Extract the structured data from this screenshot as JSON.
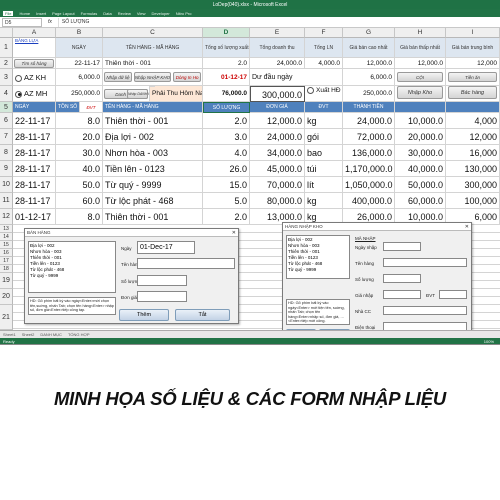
{
  "window": {
    "title": "LoDep(040).xlsx - Microsoft Excel"
  },
  "ribbon_tabs": [
    "File",
    "Home",
    "Insert",
    "Page Layout",
    "Formulas",
    "Data",
    "Review",
    "View",
    "Developer",
    "Nitro Pro"
  ],
  "formula_bar": {
    "name_box": "D5",
    "fx": "fx",
    "value": "SỐ LƯỢNG"
  },
  "columns": [
    "A",
    "B",
    "C",
    "D",
    "E",
    "F",
    "G",
    "H",
    "I"
  ],
  "rows": [
    "1",
    "2",
    "3",
    "4",
    "5",
    "6",
    "7",
    "8",
    "9",
    "10",
    "11",
    "12",
    "13",
    "14",
    "15",
    "16",
    "17",
    "18",
    "19",
    "20",
    "21"
  ],
  "top": {
    "r1": {
      "a_link": "BẢNG LỰA",
      "b": "NGÀY",
      "c": "TÊN HÀNG - MÃ HÀNG",
      "d": "Tổng số lượng xuất",
      "e": "Tổng doanh thu",
      "f": "Tổng LN",
      "g": "Giá bán cao nhất",
      "h": "Giá bán thấp nhất",
      "i": "Giá bán trung bình"
    },
    "r2": {
      "a_btn": "Tìm số hàng",
      "b": "22-11-17",
      "c": "Thiên thời - 001",
      "d": "2.0",
      "e": "24,000.0",
      "f": "4,000.0",
      "g": "12,000.0",
      "h": "12,000.0",
      "i": "12,000"
    },
    "r3": {
      "a_radio": "AZ KH",
      "b": "6,000.0",
      "btn1": "Nhập dữ liệ",
      "btn2": "Nhập NHẬP KHO",
      "btn3": "Dòng In Ho",
      "d_date": "01-12-17",
      "e": "Dư đầu ngày",
      "g": "6,000.0",
      "h": "CỘI",
      "i": "Tiền ăn"
    },
    "r4": {
      "a_radio": "AZ MH",
      "b": "250,000.0",
      "btn1": "Danh sách",
      "btn2": "Nhập DANH HÀNG",
      "c_text": "Phải Thu Hôm Nay",
      "d": "76,000.0",
      "e": "300,000.0",
      "f_radio": "Xuất HĐ",
      "g": "250,000.0",
      "h_btn": "Nhập Kho",
      "i_btn": "Bác hàng"
    },
    "r5": {
      "a": "NGÀY",
      "b1": "TỒN SỐ",
      "b2": "ĐVT",
      "c": "TÊN HÀNG - MÃ HÀNG",
      "d": "SỐ LƯỢNG",
      "e": "ĐƠN GIÁ",
      "f": "ĐVT",
      "g": "THÀNH TIỀN",
      "h": "",
      "i": ""
    }
  },
  "data_rows": [
    {
      "a": "22-11-17",
      "b": "8.0",
      "c": "Thiên thời - 001",
      "d": "2.0",
      "e": "12,000.0",
      "f": "kg",
      "g": "24,000.0",
      "h": "10,000.0",
      "i": "4,000"
    },
    {
      "a": "28-11-17",
      "b": "20.0",
      "c": "Địa lợi - 002",
      "d": "3.0",
      "e": "24,000.0",
      "f": "gói",
      "g": "72,000.0",
      "h": "20,000.0",
      "i": "12,000"
    },
    {
      "a": "28-11-17",
      "b": "30.0",
      "c": "Nhơn hòa - 003",
      "d": "4.0",
      "e": "34,000.0",
      "f": "bao",
      "g": "136,000.0",
      "h": "30,000.0",
      "i": "16,000"
    },
    {
      "a": "28-11-17",
      "b": "40.0",
      "c": "Tiền lên - 0123",
      "d": "26.0",
      "e": "45,000.0",
      "f": "túi",
      "g": "1,170,000.0",
      "h": "40,000.0",
      "i": "130,000"
    },
    {
      "a": "28-11-17",
      "b": "50.0",
      "c": "Từ quý - 9999",
      "d": "15.0",
      "e": "70,000.0",
      "f": "lít",
      "g": "1,050,000.0",
      "h": "50,000.0",
      "i": "300,000"
    },
    {
      "a": "28-11-17",
      "b": "60.0",
      "c": "Từ lộc phát - 468",
      "d": "5.0",
      "e": "80,000.0",
      "f": "kg",
      "g": "400,000.0",
      "h": "60,000.0",
      "i": "100,000"
    },
    {
      "a": "01-12-17",
      "b": "8.0",
      "c": "Thiên thời - 001",
      "d": "2.0",
      "e": "13,000.0",
      "f": "kg",
      "g": "26,000.0",
      "h": "10,000.0",
      "i": "6,000"
    }
  ],
  "form_ban": {
    "title": "BÁN HÀNG",
    "list": [
      "Địa lợi - 002",
      "Nhơn hòa - 003",
      "Thiên thời - 001",
      "Tiền lên - 0123",
      "Từ lộc phát - 468",
      "Từ quý - 9999"
    ],
    "note": "HD: Gõ phím bất kỳ vào ngày<Enter>mới chọn tên,suờng, nhấn Tab; chọn tên hàng<Enter> nhập số, đơn giá<Enter>tiếp công tạp.",
    "lbl_ngay": "Ngày",
    "ngay": "01-Dec-17",
    "lbl_ten": "Tên hàng",
    "lbl_sl": "Số lượng",
    "lbl_dg": "Đơn giá",
    "btn_them": "Thêm",
    "btn_tat": "Tắt"
  },
  "form_nhap": {
    "title": "HÀNG NHẬP KHO",
    "list": [
      "Địa lợi - 002",
      "Nhơn hòa - 003",
      "Thiên thời - 001",
      "Tiền lên - 0123",
      "Từ lộc phát - 468",
      "Từ quý - 9999"
    ],
    "note": "HD: Gõ phím bất kỳ vào ngày<Enter> mới tiện tên, suờng, nhấn Tab; chọn tên hàng<Enter>nhập số, đơn giá, ...<Enter>tiếp mới công.",
    "lbl_mak": "MÃ NHẬP",
    "lbl_ngay": "Ngày nhập",
    "lbl_ten": "Tên hàng",
    "lbl_sl": "Số lượng",
    "lbl_gn": "Giá nhập",
    "lbl_dvt": "ĐVT",
    "lbl_ncc": "Nhà CC",
    "lbl_dt": "Điện thoại",
    "btn_them": "THÊM",
    "btn_tat": "TẮT"
  },
  "sheet_tabs": [
    "Sheet1",
    "Sheet2",
    "DANH MỤC",
    "TỔNG HỢP"
  ],
  "status": {
    "ready": "Ready",
    "zoom": "100%"
  },
  "caption": "MINH HỌA SỐ LIỆU & CÁC FORM NHẬP LIỆU"
}
